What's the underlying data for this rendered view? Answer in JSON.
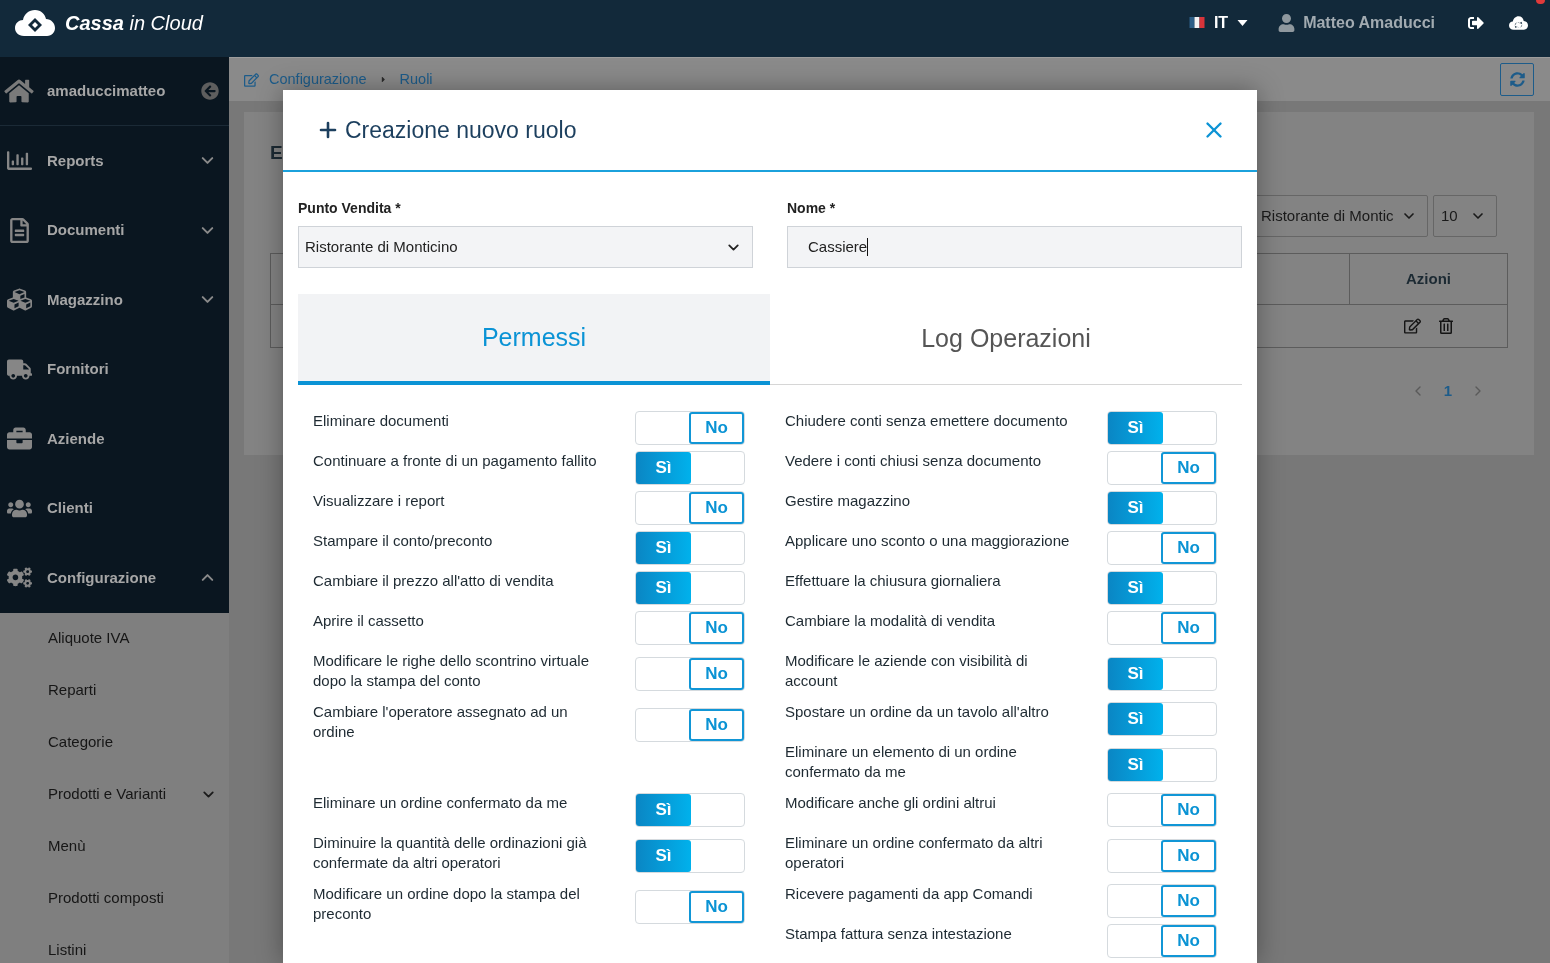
{
  "top_bar": {
    "logo_text": "**Cassa** in Cloud",
    "language": "IT",
    "user": "Matteo Amaducci"
  },
  "sidebar": {
    "account": "amaduccimatteo",
    "items": [
      {
        "label": "Reports",
        "kind": "group",
        "expanded": false
      },
      {
        "label": "Documenti",
        "kind": "group",
        "expanded": false
      },
      {
        "label": "Magazzino",
        "kind": "group",
        "expanded": false
      },
      {
        "label": "Fornitori",
        "kind": "link"
      },
      {
        "label": "Aziende",
        "kind": "link"
      },
      {
        "label": "Clienti",
        "kind": "link"
      },
      {
        "label": "Configurazione",
        "kind": "group",
        "expanded": true,
        "children": [
          {
            "label": "Aliquote IVA",
            "kind": "link"
          },
          {
            "label": "Reparti",
            "kind": "link"
          },
          {
            "label": "Categorie",
            "kind": "link"
          },
          {
            "label": "Prodotti e Varianti",
            "kind": "group",
            "expanded": false
          },
          {
            "label": "Menù",
            "kind": "link"
          },
          {
            "label": "Prodotti composti",
            "kind": "link"
          },
          {
            "label": "Listini",
            "kind": "link"
          }
        ]
      }
    ]
  },
  "breadcrumb": [
    "Configurazione",
    "Ruoli"
  ],
  "page": {
    "title": "E",
    "store_filter": "Ristorante di Montic",
    "page_size": "10",
    "table": {
      "columns": [
        "Azioni"
      ]
    },
    "pagination": {
      "pages": [
        {
          "label": "1",
          "selected": true
        }
      ]
    }
  },
  "modal": {
    "title": "Creazione nuovo ruolo",
    "fields": [
      {
        "label": "Punto Vendita *",
        "kind": "select",
        "value": "Ristorante di Monticino"
      },
      {
        "label": "Nome *",
        "kind": "text",
        "value": "Cassiere",
        "focused": true
      }
    ],
    "tabs": [
      {
        "label": "Permessi",
        "selected": true
      },
      {
        "label": "Log Operazioni",
        "selected": false
      }
    ],
    "permissions": [
      {
        "label": "Eliminare documenti",
        "on": false,
        "value": "No"
      },
      {
        "label": "Chiudere conti senza emettere documento",
        "on": true,
        "value": "Sì"
      },
      {
        "label": "Continuare a fronte di un pagamento fallito",
        "on": true,
        "value": "Sì"
      },
      {
        "label": "Vedere i conti chiusi senza documento",
        "on": false,
        "value": "No"
      },
      {
        "label": "Visualizzare i report",
        "on": false,
        "value": "No"
      },
      {
        "label": "Gestire magazzino",
        "on": true,
        "value": "Sì"
      },
      {
        "label": "Stampare il conto/preconto",
        "on": true,
        "value": "Sì"
      },
      {
        "label": "Applicare uno sconto o una maggiorazione",
        "on": false,
        "value": "No"
      },
      {
        "label": "Cambiare il prezzo all'atto di vendita",
        "on": true,
        "value": "Sì"
      },
      {
        "label": "Effettuare la chiusura giornaliera",
        "on": true,
        "value": "Sì"
      },
      {
        "label": "Aprire il cassetto",
        "on": false,
        "value": "No"
      },
      {
        "label": "Cambiare la modalità di vendita",
        "on": false,
        "value": "No"
      },
      {
        "label": "Modificare le righe dello scontrino virtuale dopo la stampa del conto",
        "on": false,
        "value": "No"
      },
      {
        "label": "Modificare le aziende con visibilità di account",
        "on": true,
        "value": "Sì"
      },
      {
        "label": "Cambiare l'operatore assegnato ad un ordine",
        "on": false,
        "value": "No"
      },
      {
        "label": "Spostare un ordine da un tavolo all'altro",
        "on": true,
        "value": "Sì"
      },
      {
        "label": "Eliminare un elemento di un ordine confermato da me",
        "on": true,
        "value": "Sì"
      },
      {
        "label": "Eliminare un ordine confermato da me",
        "on": true,
        "value": "Sì"
      },
      {
        "label": "Modificare anche gli ordini altrui",
        "on": false,
        "value": "No"
      },
      {
        "label": "Diminuire la quantità delle ordinazioni già confermate da altri operatori",
        "on": true,
        "value": "Sì"
      },
      {
        "label": "Eliminare un ordine confermato da altri operatori",
        "on": false,
        "value": "No"
      },
      {
        "label": "Modificare un ordine dopo la stampa del preconto",
        "on": false,
        "value": "No"
      },
      {
        "label": "Ricevere pagamenti da app Comandi",
        "on": false,
        "value": "No"
      },
      {
        "label": "Stampa fattura senza intestazione",
        "on": false,
        "value": "No"
      }
    ]
  }
}
